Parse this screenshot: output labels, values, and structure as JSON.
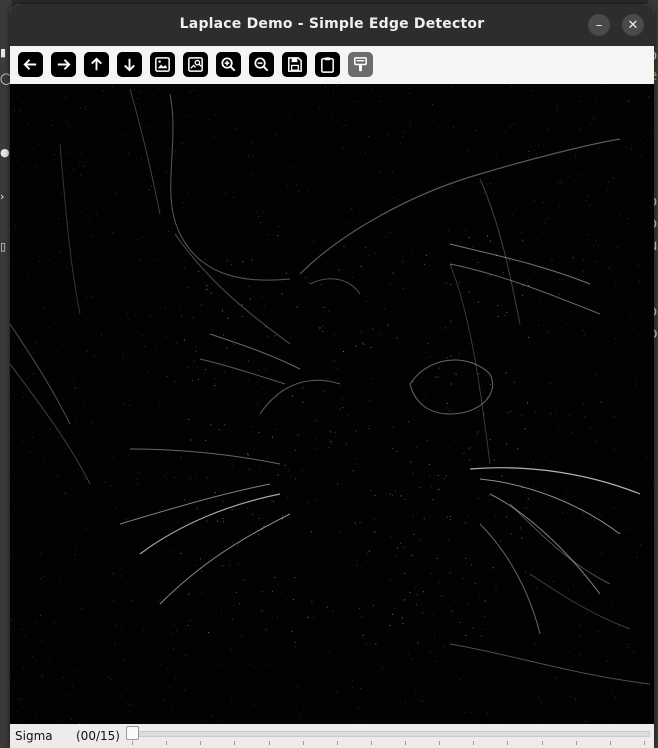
{
  "window": {
    "title": "Laplace Demo - Simple Edge Detector"
  },
  "toolbar": {
    "buttons": [
      {
        "icon": "arrow-left-icon",
        "enabled": true
      },
      {
        "icon": "arrow-right-icon",
        "enabled": true
      },
      {
        "icon": "arrow-up-icon",
        "enabled": true
      },
      {
        "icon": "arrow-down-icon",
        "enabled": true
      },
      {
        "icon": "image-icon",
        "enabled": true
      },
      {
        "icon": "image-search-icon",
        "enabled": true
      },
      {
        "icon": "zoom-in-icon",
        "enabled": true
      },
      {
        "icon": "zoom-out-icon",
        "enabled": true
      },
      {
        "icon": "save-icon",
        "enabled": true
      },
      {
        "icon": "clipboard-icon",
        "enabled": true
      },
      {
        "icon": "properties-icon",
        "enabled": false
      }
    ]
  },
  "trackbar": {
    "label": "Sigma",
    "value_text": "(00/15)",
    "value": 0,
    "max": 15
  },
  "background": {
    "right_edge_glyphs": [
      "o",
      "e",
      "o",
      "o",
      "u",
      ".",
      "o",
      "p"
    ]
  },
  "colors": {
    "titlebar": "#2d2d2d",
    "toolbar_button": "#000000",
    "canvas": "#020202",
    "edge": "#ffffff"
  }
}
